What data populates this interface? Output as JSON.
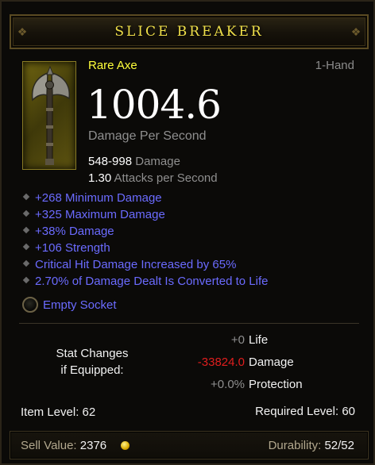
{
  "item": {
    "name": "SLICE BREAKER",
    "type": "Rare Axe",
    "slot": "1-Hand",
    "dps": "1004.6",
    "dps_label": "Damage Per Second",
    "damage_range": "548-998",
    "damage_label": "Damage",
    "attacks_per_second": "1.30",
    "aps_label": "Attacks per Second"
  },
  "affixes": [
    "+268 Minimum Damage",
    "+325 Maximum Damage",
    "+38% Damage",
    "+106 Strength",
    "Critical Hit Damage Increased by 65%",
    "2.70% of Damage Dealt Is Converted to Life"
  ],
  "socket": {
    "label": "Empty Socket"
  },
  "stat_changes": {
    "heading_line1": "Stat Changes",
    "heading_line2": "if Equipped:",
    "rows": [
      {
        "value": "+0",
        "label": "Life",
        "tone": "neutral"
      },
      {
        "value": "-33824.0",
        "label": "Damage",
        "tone": "negative"
      },
      {
        "value": "+0.0%",
        "label": "Protection",
        "tone": "neutral"
      }
    ]
  },
  "levels": {
    "item_level_label": "Item Level:",
    "item_level": "62",
    "required_level_label": "Required Level:",
    "required_level": "60"
  },
  "footer": {
    "sell_label": "Sell Value:",
    "sell_value": "2376",
    "durability_label": "Durability:",
    "durability_value": "52/52"
  },
  "colors": {
    "title": "#f0e04a",
    "rare_type": "#ffff3a",
    "magic_affix": "#6b6bff",
    "negative": "#e01e1e",
    "muted": "#8f8f8f"
  },
  "icons": {
    "item": "axe-icon",
    "socket": "socket-icon",
    "gold": "gold-coin-icon"
  }
}
